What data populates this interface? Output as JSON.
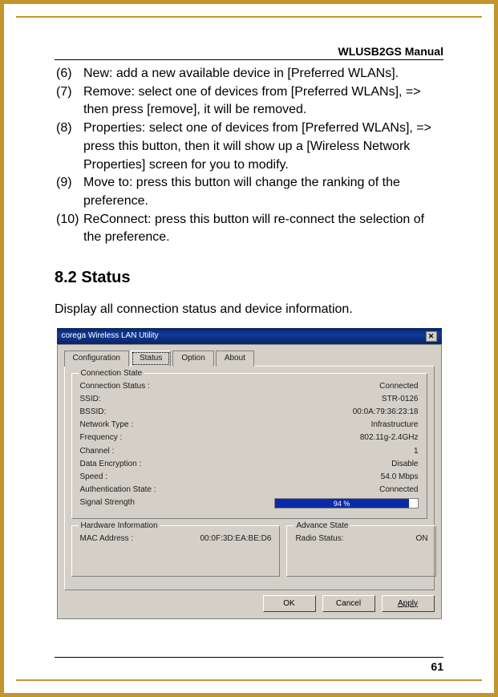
{
  "header": {
    "manual_title": "WLUSB2GS Manual"
  },
  "list_items": [
    {
      "num": "(6)",
      "text": "New: add a new available device in [Preferred WLANs]."
    },
    {
      "num": "(7)",
      "text": "Remove: select one of devices from [Preferred WLANs], => then press [remove], it will be removed."
    },
    {
      "num": "(8)",
      "text": "Properties: select one of devices from [Preferred WLANs], => press this button, then it will show up a [Wireless Network Properties] screen for you to modify."
    },
    {
      "num": "(9)",
      "text": "Move to: press this button will change the ranking of the preference."
    },
    {
      "num": "(10)",
      "text": "ReConnect: press this button will re-connect the selection of the preference."
    }
  ],
  "section": {
    "title": "8.2 Status",
    "description": "Display all connection status and device information."
  },
  "dialog": {
    "title": "corega Wireless LAN Utility",
    "close_glyph": "✕",
    "tabs": [
      "Configuration",
      "Status",
      "Option",
      "About"
    ],
    "group_conn_legend": "Connection State",
    "conn_rows": [
      {
        "label": "Connection Status :",
        "value": "Connected"
      },
      {
        "label": "SSID:",
        "value": "STR-0126"
      },
      {
        "label": "BSSID:",
        "value": "00:0A:79:36:23:18"
      },
      {
        "label": "Network Type :",
        "value": "Infrastructure"
      },
      {
        "label": "Frequency :",
        "value": "802.11g-2.4GHz"
      },
      {
        "label": "Channel :",
        "value": "1"
      },
      {
        "label": "Data Encryption :",
        "value": "Disable"
      },
      {
        "label": "Speed :",
        "value": "54.0  Mbps"
      },
      {
        "label": "Authentication State :",
        "value": "Connected"
      }
    ],
    "signal_label": "Signal Strength",
    "signal_pct_text": "94 %",
    "signal_pct_width": "94%",
    "group_hw_legend": "Hardware Information",
    "hw_label": "MAC Address :",
    "hw_value": "00:0F:3D:EA:BE:D6",
    "group_adv_legend": "Advance State",
    "adv_label": "Radio Status:",
    "adv_value": "ON",
    "buttons": {
      "ok": "OK",
      "cancel": "Cancel",
      "apply": "Apply"
    }
  },
  "page_number": "61"
}
